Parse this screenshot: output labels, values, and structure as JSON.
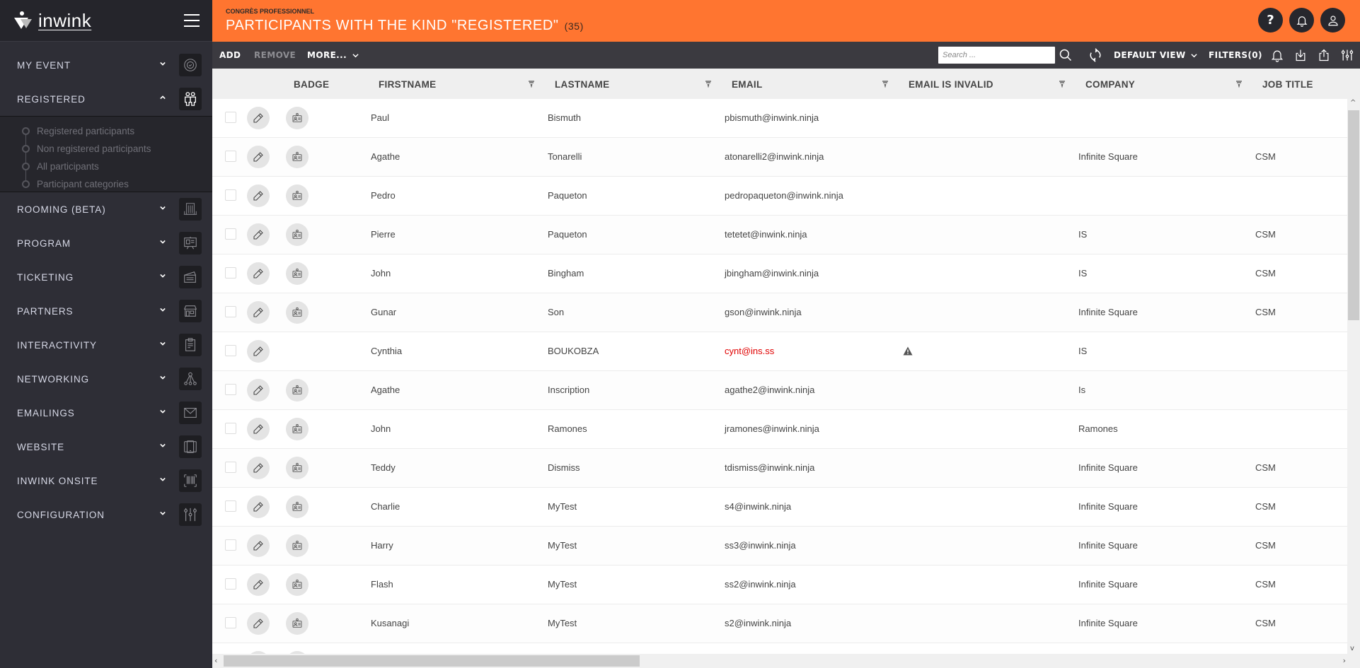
{
  "app": {
    "logo_text": "inwink"
  },
  "sidebar": {
    "items": [
      {
        "label": "MY EVENT",
        "icon": "event-badge-icon",
        "expanded": false
      },
      {
        "label": "REGISTERED",
        "icon": "people-icon",
        "expanded": true
      },
      {
        "label": "ROOMING (BETA)",
        "icon": "building-icon",
        "expanded": false
      },
      {
        "label": "PROGRAM",
        "icon": "presentation-board-icon",
        "expanded": false
      },
      {
        "label": "TICKETING",
        "icon": "tickets-icon",
        "expanded": false
      },
      {
        "label": "PARTNERS",
        "icon": "storefront-icon",
        "expanded": false
      },
      {
        "label": "INTERACTIVITY",
        "icon": "clipboard-icon",
        "expanded": false
      },
      {
        "label": "NETWORKING",
        "icon": "network-icon",
        "expanded": false
      },
      {
        "label": "EMAILINGS",
        "icon": "envelope-icon",
        "expanded": false
      },
      {
        "label": "WEBSITE",
        "icon": "devices-icon",
        "expanded": false
      },
      {
        "label": "INWINK ONSITE",
        "icon": "barcode-icon",
        "expanded": false
      },
      {
        "label": "CONFIGURATION",
        "icon": "sliders-icon",
        "expanded": false
      }
    ],
    "registered_submenu": [
      "Registered participants",
      "Non registered participants",
      "All participants",
      "Participant categories"
    ]
  },
  "header": {
    "event_name": "CONGRÈS PROFESSIONNEL",
    "title": "PARTICIPANTS WITH THE KIND \"REGISTERED\"",
    "count": "(35)",
    "accent_color": "#ff7530",
    "help_label": "?"
  },
  "toolbar": {
    "add_label": "ADD",
    "remove_label": "REMOVE",
    "more_label": "MORE...",
    "search_placeholder": "Search ...",
    "search_value": "",
    "view_label": "DEFAULT VIEW",
    "filters_label": "FILTERS(0)"
  },
  "grid": {
    "columns": [
      "BADGE",
      "FIRSTNAME",
      "LASTNAME",
      "EMAIL",
      "EMAIL IS INVALID",
      "COMPANY",
      "JOB TITLE"
    ],
    "rows": [
      {
        "firstname": "Paul",
        "lastname": "Bismuth",
        "email": "pbismuth@inwink.ninja",
        "email_invalid": false,
        "company": "",
        "job_title": "",
        "has_badge": true
      },
      {
        "firstname": "Agathe",
        "lastname": "Tonarelli",
        "email": "atonarelli2@inwink.ninja",
        "email_invalid": false,
        "company": "Infinite Square",
        "job_title": "CSM",
        "has_badge": true
      },
      {
        "firstname": "Pedro",
        "lastname": "Paqueton",
        "email": "pedropaqueton@inwink.ninja",
        "email_invalid": false,
        "company": "",
        "job_title": "",
        "has_badge": true
      },
      {
        "firstname": "Pierre",
        "lastname": "Paqueton",
        "email": "tetetet@inwink.ninja",
        "email_invalid": false,
        "company": "IS",
        "job_title": "CSM",
        "has_badge": true
      },
      {
        "firstname": "John",
        "lastname": "Bingham",
        "email": "jbingham@inwink.ninja",
        "email_invalid": false,
        "company": "IS",
        "job_title": "CSM",
        "has_badge": true
      },
      {
        "firstname": "Gunar",
        "lastname": "Son",
        "email": "gson@inwink.ninja",
        "email_invalid": false,
        "company": "Infinite Square",
        "job_title": "CSM",
        "has_badge": true
      },
      {
        "firstname": "Cynthia",
        "lastname": "BOUKOBZA",
        "email": "cynt@ins.ss",
        "email_invalid": true,
        "company": "IS",
        "job_title": "",
        "has_badge": false
      },
      {
        "firstname": "Agathe",
        "lastname": "Inscription",
        "email": "agathe2@inwink.ninja",
        "email_invalid": false,
        "company": "Is",
        "job_title": "",
        "has_badge": true
      },
      {
        "firstname": "John",
        "lastname": "Ramones",
        "email": "jramones@inwink.ninja",
        "email_invalid": false,
        "company": "Ramones",
        "job_title": "",
        "has_badge": true
      },
      {
        "firstname": "Teddy",
        "lastname": "Dismiss",
        "email": "tdismiss@inwink.ninja",
        "email_invalid": false,
        "company": "Infinite Square",
        "job_title": "CSM",
        "has_badge": true
      },
      {
        "firstname": "Charlie",
        "lastname": "MyTest",
        "email": "s4@inwink.ninja",
        "email_invalid": false,
        "company": "Infinite Square",
        "job_title": "CSM",
        "has_badge": true
      },
      {
        "firstname": "Harry",
        "lastname": "MyTest",
        "email": "ss3@inwink.ninja",
        "email_invalid": false,
        "company": "Infinite Square",
        "job_title": "CSM",
        "has_badge": true
      },
      {
        "firstname": "Flash",
        "lastname": "MyTest",
        "email": "ss2@inwink.ninja",
        "email_invalid": false,
        "company": "Infinite Square",
        "job_title": "CSM",
        "has_badge": true
      },
      {
        "firstname": "Kusanagi",
        "lastname": "MyTest",
        "email": "s2@inwink.ninja",
        "email_invalid": false,
        "company": "Infinite Square",
        "job_title": "CSM",
        "has_badge": true
      },
      {
        "firstname": "",
        "lastname": "",
        "email": "",
        "email_invalid": false,
        "company": "",
        "job_title": "",
        "has_badge": true
      }
    ],
    "invalid_email_color": "#e00000"
  }
}
